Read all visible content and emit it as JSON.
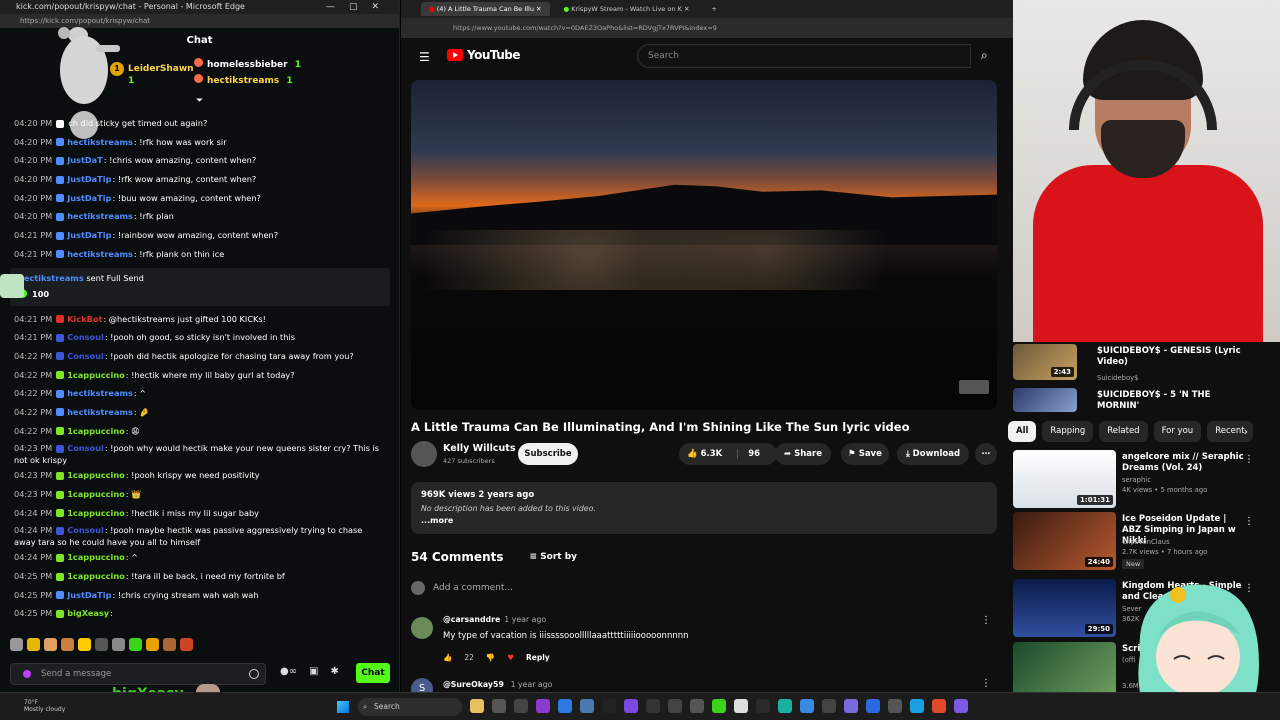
{
  "kick": {
    "window_title": "kick.com/popout/krispyw/chat - Personal - Microsoft Edge",
    "url": "https://kick.com/popout/krispyw/chat",
    "chat_header": "Chat",
    "gifters": [
      {
        "name": "LeiderShawn",
        "count": "1"
      },
      {
        "name": "homelessbieber",
        "count": "1"
      },
      {
        "name": "hectikstreams",
        "count": "1"
      }
    ],
    "messages_top": [
      {
        "time": "04:20 PM",
        "user": "",
        "text": "ch did sticky get timed out again?",
        "color": "#ffffff"
      },
      {
        "time": "04:20 PM",
        "user": "hectikstreams",
        "text": ": !rfk how was work sir",
        "color": "#4e8cff"
      },
      {
        "time": "04:20 PM",
        "user": "JustDaT",
        "text": ": !chris wow amazing, content when?",
        "color": "#4e8cff"
      },
      {
        "time": "04:20 PM",
        "user": "JustDaTip",
        "text": ": !rfk wow amazing, content when?",
        "color": "#4e8cff"
      },
      {
        "time": "04:20 PM",
        "user": "JustDaTip",
        "text": ": !buu wow amazing, content when?",
        "color": "#4e8cff"
      },
      {
        "time": "04:20 PM",
        "user": "hectikstreams",
        "text": ": !rfk plan",
        "color": "#4e8cff"
      },
      {
        "time": "04:21 PM",
        "user": "JustDaTip",
        "text": ": !rainbow wow amazing, content when?",
        "color": "#4e8cff"
      },
      {
        "time": "04:21 PM",
        "user": "hectikstreams",
        "text": ": !rfk plank on thin ice",
        "color": "#4e8cff"
      }
    ],
    "gift": {
      "user": "hectikstreams",
      "text": " sent Full Send",
      "amount": "100"
    },
    "messages_bottom": [
      {
        "time": "04:21 PM",
        "user": "KickBot",
        "text": ": @hectikstreams just gifted 100 KICKs!",
        "color": "#e0302a"
      },
      {
        "time": "04:21 PM",
        "user": "Consoul",
        "text": ": !pooh oh good, so sticky isn't involved in this",
        "color": "#3d55d8"
      },
      {
        "time": "04:22 PM",
        "user": "Consoul",
        "text": ": !pooh did hectik apologize for chasing tara away from you?",
        "color": "#3d55d8"
      },
      {
        "time": "04:22 PM",
        "user": "1cappuccino",
        "text": ": !hectik where my lil baby gurl at today?",
        "color": "#7ee52a"
      },
      {
        "time": "04:22 PM",
        "user": "hectikstreams",
        "text": ": ^",
        "color": "#4e8cff"
      },
      {
        "time": "04:22 PM",
        "user": "hectikstreams",
        "text": ": 🤌",
        "color": "#4e8cff"
      },
      {
        "time": "04:22 PM",
        "user": "1cappuccino",
        "text": ": 😩",
        "color": "#7ee52a"
      },
      {
        "time": "04:23 PM",
        "user": "Consoul",
        "text": ": !pooh why would hectik make your new queens sister cry? This is not ok krispy",
        "color": "#3d55d8",
        "two": true
      },
      {
        "time": "04:23 PM",
        "user": "1cappuccino",
        "text": ": !pooh krispy we need positivity",
        "color": "#7ee52a"
      },
      {
        "time": "04:23 PM",
        "user": "1cappuccino",
        "text": ": 👑",
        "color": "#7ee52a"
      },
      {
        "time": "04:24 PM",
        "user": "1cappuccino",
        "text": ": !hectik i miss my lil sugar baby",
        "color": "#7ee52a"
      },
      {
        "time": "04:24 PM",
        "user": "Consoul",
        "text": ": !pooh maybe hectik was passive aggressively trying to chase away tara so he could have you all to himself",
        "color": "#3d55d8",
        "two": true
      },
      {
        "time": "04:24 PM",
        "user": "1cappuccino",
        "text": ": ^",
        "color": "#7ee52a"
      },
      {
        "time": "04:25 PM",
        "user": "1cappuccino",
        "text": ": !tara ill be back, i need my fortnite bf",
        "color": "#7ee52a"
      },
      {
        "time": "04:25 PM",
        "user": "JustDaTip",
        "text": ": !chris crying stream wah wah wah",
        "color": "#4e8cff"
      },
      {
        "time": "04:25 PM",
        "user": "bigXeasy",
        "text": ":",
        "color": "#7ee52a"
      }
    ],
    "send_placeholder": "Send a message",
    "chat_button": "Chat",
    "overlay_text": "bigXeasy"
  },
  "youtube": {
    "tabs": [
      {
        "label": "(4) A Little Trauma Can Be Illu",
        "active": true
      },
      {
        "label": "KrispyW Stream - Watch Live on K",
        "active": false
      }
    ],
    "url": "https://www.youtube.com/watch?v=0DAEZ3OaPho&list=RDVgjTx7RVPI&index=9",
    "logo_text": "YouTube",
    "search_placeholder": "Search",
    "video_title": "A Little Trauma Can Be Illuminating, And I'm Shining Like The Sun lyric video",
    "channel": {
      "name": "Kelly Willcuts",
      "subs": "427 subscribers"
    },
    "subscribe_label": "Subscribe",
    "likes": "6.3K",
    "dislikes": "96",
    "share_label": "Share",
    "save_label": "Save",
    "download_label": "Download",
    "views": "969K views  2 years ago",
    "description": "No description has been added to this video.",
    "more_label": "...more",
    "comments_count": "54 Comments",
    "sort_label": "Sort by",
    "add_comment": "Add a comment...",
    "comments": [
      {
        "user": "@carsanddre",
        "time": "1 year ago",
        "text": "My type of vacation is iiissssooolllllaaatttttiiiiiooooonnnnn",
        "likes": "22",
        "reply": "Reply"
      },
      {
        "user": "@SureOkay59",
        "time": "1 year ago",
        "initial": "S"
      }
    ]
  },
  "sidebar": {
    "top_items": [
      {
        "title": "$UICIDEBOY$ - GENESIS (Lyric Video)",
        "channel": "Suicideboy$",
        "duration": "2:43"
      },
      {
        "title": "$UICIDEBOY$ - 5 'N THE MORNIN'",
        "channel": ""
      }
    ],
    "chips": [
      "All",
      "Rapping",
      "Related",
      "For you",
      "Recent"
    ],
    "items": [
      {
        "title": "angelcore mix // Seraphic Dreams (Vol. 24)",
        "channel": "seraphic",
        "meta": "4K views • 5 months ago",
        "duration": "1:01:31"
      },
      {
        "title": "Ice Poseidon Update | ABZ Simping in Japan w Nikki",
        "channel": "ClipsVonClaus",
        "meta": "2.7K views • 7 hours ago",
        "badge": "New",
        "duration": "24:40"
      },
      {
        "title": "Kingdom Hearts - Simple and Clean (Orchestral)",
        "channel": "Sever",
        "meta": "362K",
        "duration": "29:50"
      },
      {
        "title": "Scri",
        "channel": "(offi",
        "meta": "3.6M",
        "duration": ""
      }
    ]
  },
  "taskbar": {
    "weather_temp": "70°F",
    "weather_desc": "Mostly cloudy",
    "search_label": "Search"
  }
}
